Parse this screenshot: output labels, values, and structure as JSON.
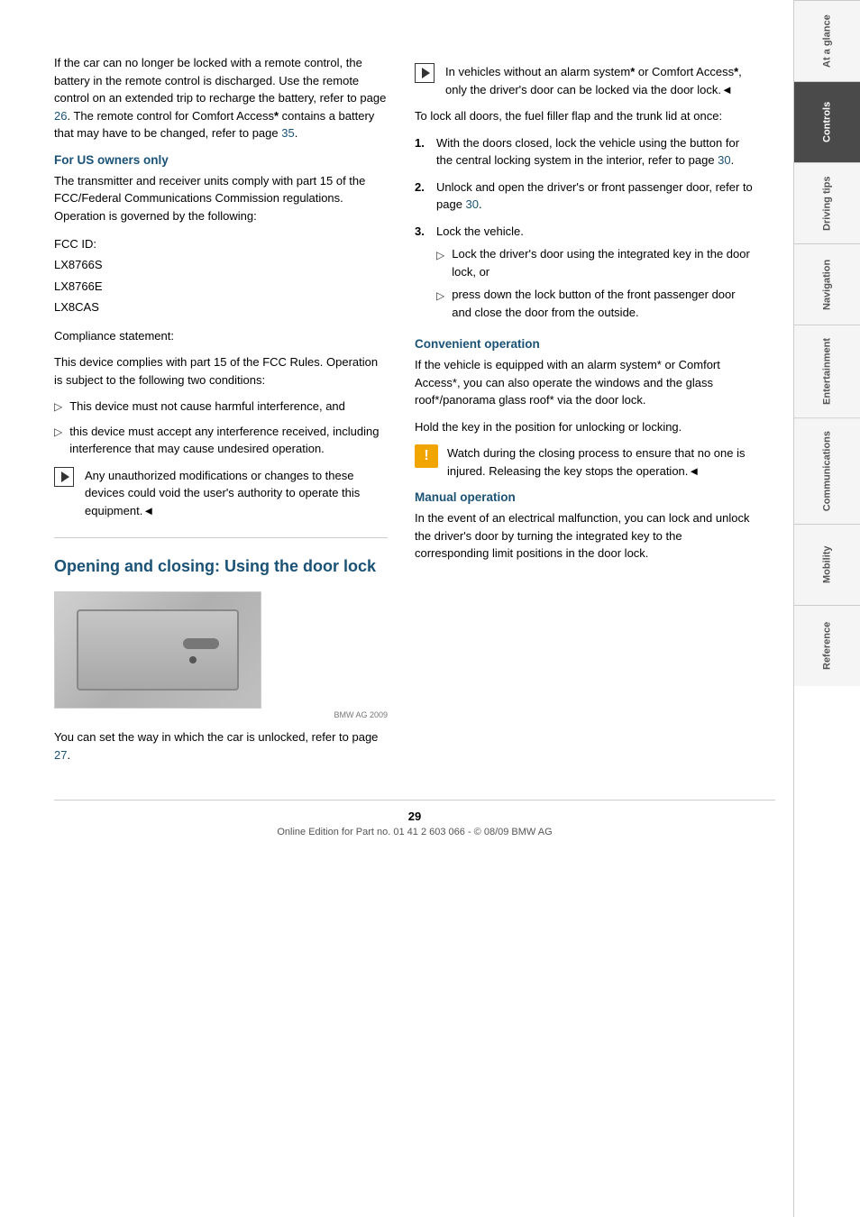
{
  "sidebar": {
    "tabs": [
      {
        "label": "At a glance",
        "active": false
      },
      {
        "label": "Controls",
        "active": true
      },
      {
        "label": "Driving tips",
        "active": false
      },
      {
        "label": "Navigation",
        "active": false
      },
      {
        "label": "Entertainment",
        "active": false
      },
      {
        "label": "Communications",
        "active": false
      },
      {
        "label": "Mobility",
        "active": false
      },
      {
        "label": "Reference",
        "active": false
      }
    ]
  },
  "left_column": {
    "intro_paragraph": "If the car can no longer be locked with a remote control, the battery in the remote control is discharged. Use the remote control on an extended trip to recharge the battery, refer to page 26. The remote control for Comfort Access* contains a battery that may have to be changed, refer to page 35.",
    "us_owners_heading": "For US owners only",
    "us_owners_paragraph": "The transmitter and receiver units comply with part 15 of the FCC/Federal Communications Commission regulations. Operation is governed by the following:",
    "fcc_ids": {
      "label": "FCC ID:",
      "ids": [
        "LX8766S",
        "LX8766E",
        "LX8CAS"
      ]
    },
    "compliance_label": "Compliance statement:",
    "compliance_paragraph": "This device complies with part 15 of the FCC Rules. Operation is subject to the following two conditions:",
    "conditions": [
      "This device must not cause harmful interference, and",
      "this device must accept any interference received, including interference that may cause undesired operation."
    ],
    "notice_text": "Any unauthorized modifications or changes to these devices could void the user's authority to operate this equipment.",
    "back_mark": "◄",
    "section_heading": "Opening and closing: Using the door lock",
    "image_caption": "You can set the way in which the car is unlocked, refer to page 27.",
    "image_watermark": "BMW AG 2009"
  },
  "right_column": {
    "notice_text": "In vehicles without an alarm system* or Comfort Access*, only the driver's door can be locked via the door lock.",
    "back_mark": "◄",
    "lock_all_intro": "To lock all doors, the fuel filler flap and the trunk lid at once:",
    "steps": [
      {
        "num": "1.",
        "text": "With the doors closed, lock the vehicle using the button for the central locking system in the interior, refer to page 30."
      },
      {
        "num": "2.",
        "text": "Unlock and open the driver's or front passenger door, refer to page 30."
      },
      {
        "num": "3.",
        "text": "Lock the vehicle."
      }
    ],
    "sub_steps": [
      "Lock the driver's door using the integrated key in the door lock, or",
      "press down the lock button of the front passenger door and close the door from the outside."
    ],
    "convenient_heading": "Convenient operation",
    "convenient_paragraph": "If the vehicle is equipped with an alarm system* or Comfort Access*, you can also operate the windows and the glass roof*/panorama glass roof* via the door lock.",
    "convenient_paragraph2": "Hold the key in the position for unlocking or locking.",
    "warning_text": "Watch during the closing process to ensure that no one is injured. Releasing the key stops the operation.",
    "warning_back_mark": "◄",
    "manual_heading": "Manual operation",
    "manual_paragraph": "In the event of an electrical malfunction, you can lock and unlock the driver's door by turning the integrated key to the corresponding limit positions in the door lock."
  },
  "footer": {
    "page_number": "29",
    "footer_text": "Online Edition for Part no. 01 41 2 603 066 - © 08/09 BMW AG"
  }
}
